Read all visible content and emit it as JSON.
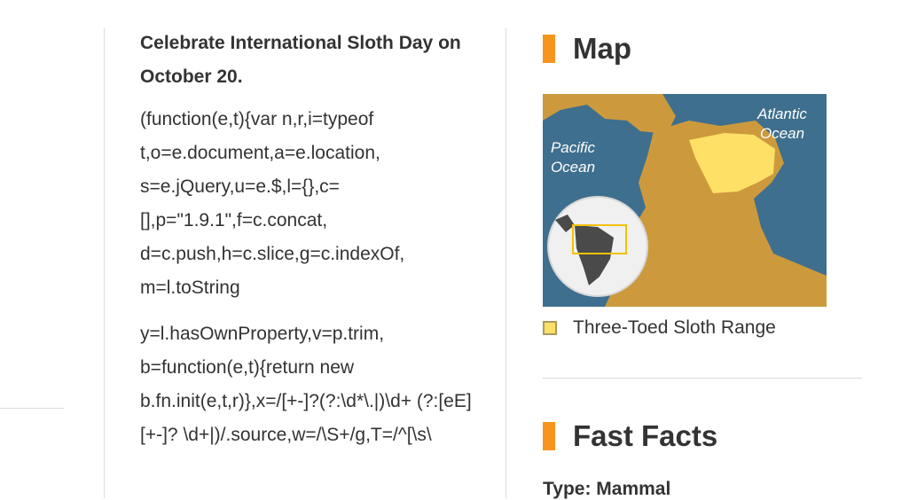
{
  "article": {
    "lead": "Celebrate International Sloth Day on October 20.",
    "code_block_1": "(function(e,t){var n,r,i=typeof t,o=e.document,a=e.location, s=e.jQuery,u=e.$,l={},c= [],p=\"1.9.1\",f=c.concat, d=c.push,h=c.slice,g=c.indexOf, m=l.toString",
    "code_block_2": "y=l.hasOwnProperty,v=p.trim, b=function(e,t){return new b.fn.init(e,t,r)},x=/[+-]?(?:\\d*\\.|)\\d+ (?:[eE][+-]? \\d+|)/.source,w=/\\S+/g,T=/^[\\s\\"
  },
  "sidebar": {
    "map_heading": "Map",
    "map_labels": {
      "atlantic_1": "Atlantic",
      "atlantic_2": "Ocean",
      "pacific_1": "Pacific",
      "pacific_2": "Ocean"
    },
    "legend_label": "Three-Toed Sloth Range",
    "facts_heading": "Fast Facts",
    "facts_peek": "Type: Mammal"
  },
  "colors": {
    "accent": "#f7941d",
    "ocean": "#3f6f8e",
    "land": "#cc9a3d",
    "range": "#ffe066"
  }
}
